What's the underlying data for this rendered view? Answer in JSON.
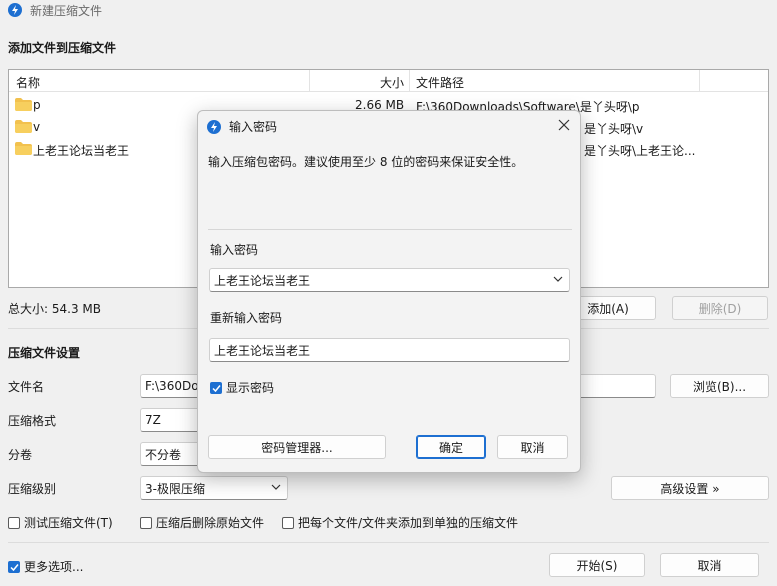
{
  "window": {
    "title": "新建压缩文件"
  },
  "add_section": {
    "title": "添加文件到压缩文件",
    "columns": {
      "name": "名称",
      "size": "大小",
      "path": "文件路径"
    },
    "files": [
      {
        "name": "p",
        "size": "2.66 MB",
        "path": "F:\\360Downloads\\Software\\是丫头呀\\p"
      },
      {
        "name": "v",
        "size": "",
        "path": "是丫头呀\\v"
      },
      {
        "name": "上老王论坛当老王",
        "size": "",
        "path": "是丫头呀\\上老王论..."
      }
    ],
    "total_size": "总大小: 54.3 MB",
    "add_button": "添加(A)",
    "delete_button": "删除(D)"
  },
  "settings": {
    "title": "压缩文件设置",
    "filename_label": "文件名",
    "filename_value": "F:\\360Dow",
    "browse_button": "浏览(B)...",
    "format_label": "压缩格式",
    "format_value": "7Z",
    "split_label": "分卷",
    "split_value": "不分卷",
    "level_label": "压缩级别",
    "level_value": "3-极限压缩",
    "advanced_button": "高级设置 »",
    "options": {
      "test": "测试压缩文件(T)",
      "delete_after": "压缩后删除原始文件",
      "each_separate": "把每个文件/文件夹添加到单独的压缩文件"
    }
  },
  "footer": {
    "more_options": "更多选项...",
    "start_button": "开始(S)",
    "cancel_button": "取消"
  },
  "dialog": {
    "title": "输入密码",
    "description": "输入压缩包密码。建议使用至少 8 位的密码来保证安全性。",
    "password_label": "输入密码",
    "password_value": "上老王论坛当老王",
    "confirm_label": "重新输入密码",
    "confirm_value": "上老王论坛当老王",
    "show_password": "显示密码",
    "manager_button": "密码管理器...",
    "ok_button": "确定",
    "cancel_button": "取消"
  },
  "colors": {
    "accent": "#1d6fd1",
    "folder": "#f2c14e"
  },
  "icons": {
    "app": "bolt-icon",
    "folder": "folder-icon",
    "close": "close-icon",
    "chevron": "chevron-down-icon",
    "check": "check-icon"
  }
}
